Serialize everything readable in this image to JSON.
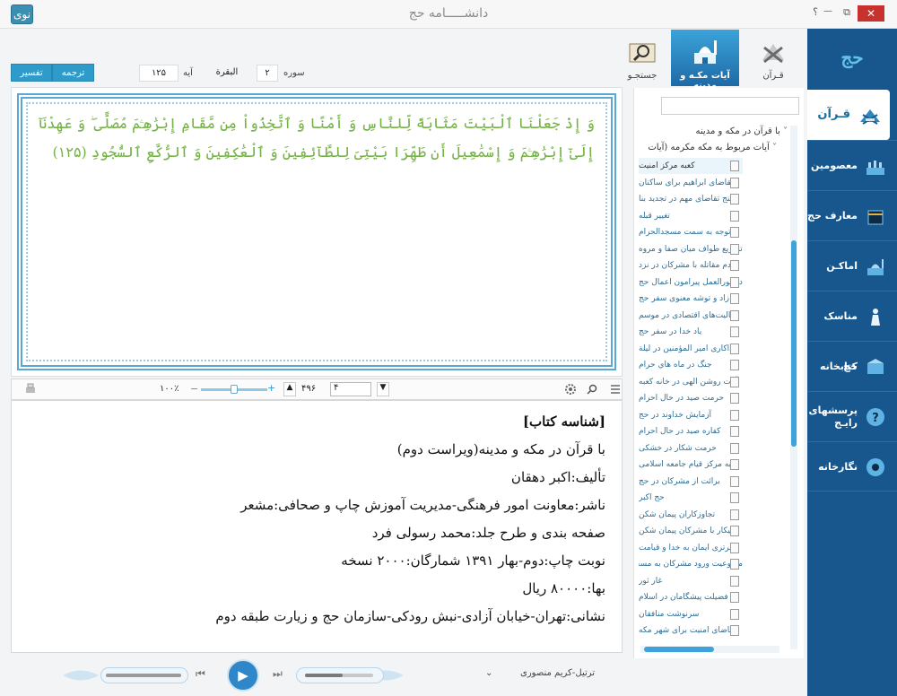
{
  "window": {
    "title": "دانشـــــامه حج",
    "app_icon_text": "نوی",
    "help": "؟",
    "restore": "⧉",
    "minimize": "—",
    "close": "✕"
  },
  "logo": "حج دانشنامه",
  "sidebar": {
    "items": [
      {
        "label": "قـرآن",
        "icon": "quran-icon",
        "active": true
      },
      {
        "label": "معصومین",
        "icon": "ruins-icon"
      },
      {
        "label": "معارف حج",
        "icon": "kaaba-icon"
      },
      {
        "label": "اماکـن",
        "icon": "mosque-icon"
      },
      {
        "label": "مناسک حج",
        "icon": "pilgrim-icon"
      },
      {
        "label": "کتابخانه",
        "icon": "library-icon"
      },
      {
        "label": "پرسشهای رایـج",
        "icon": "faq-icon"
      },
      {
        "label": "نگارخانه",
        "icon": "gallery-icon"
      }
    ]
  },
  "tabs": [
    {
      "label": "قـرآن",
      "icon": "quran-stand-icon"
    },
    {
      "label": "آیات مکـه و مدینه",
      "icon": "mosque-tab-icon",
      "active": true
    },
    {
      "label": "جستجـو",
      "icon": "book-search-icon"
    }
  ],
  "verse_nav": {
    "surah_label": "سوره",
    "surah_number": "۲",
    "surah_name": "البقرة",
    "ayah_label": "آیه",
    "ayah_number": "۱۲۵",
    "translation_button": "ترجمه",
    "tafsir_button": "تفسیر"
  },
  "verse": {
    "text": "وَ إِذْ جَعَلْنَا ٱلْبَيْتَ مَثَابَةً لِّلنَّاسِ وَ أَمْنًا وَ ٱتَّخِذُواْ مِن مَّقَامِ إِبْرَٰهِـۧمَ مُصَلًّى ۖ وَ عَهِدْنَآ إِلَىٰٓ إِبْرَٰهِـۧمَ وَ إِسْمَٰعِيلَ أَن طَهِّرَا بَيْتِىَ لِلطَّآئِفِينَ وَ ٱلْعَٰكِفِينَ وَ ٱلرُّكَّعِ ٱلسُّجُودِ",
    "number": "(۱۲۵)"
  },
  "doc_toolbar": {
    "zoom": "۱۰۰٪",
    "page_current": "۴",
    "page_total": "۴۹۶",
    "zoom_level": 0.5
  },
  "doc": {
    "heading": "[شناسه کتاب]",
    "lines": [
      "با قرآن در مکه و مدینه(ویراست دوم)",
      "تألیف:اکبر دهقان",
      "ناشر:معاونت امور فرهنگی-مدیریت آموزش چاپ و صحافی:مشعر",
      "صفحه بندی و طرح جلد:محمد رسولی فرد",
      "نوبت چاپ:دوم-بهار ۱۳۹۱ شمارگان:۲۰۰۰ نسخه",
      "بها:۸۰۰۰۰ ریال",
      "نشانی:تهران-خیابان آزادی-نبش رودکی-سازمان حج و زیارت طبقه دوم"
    ]
  },
  "tree": {
    "root": "با قرآن در مکه و مدینه",
    "group": "آیات مربوط به مکه مکرمه (آیات",
    "items": [
      "کعبه مرکز امنیت",
      "تقاضای ابراهیم برای ساکنان",
      "پنج تقاضای مهم در تجدید بنا",
      "تغییر قبله",
      "توجه به سمت مسجدالحرام",
      "تشریع طواف میان صفا و مروه",
      "عدم مقاتله با مشرکان در نزد",
      "دستورالعمل پیرامون اعمال حج",
      "زاد و توشه معنوی سفر حج",
      "فعالیت‌های اقتصادی در موسم",
      "یاد خدا در سفر حج",
      "فداکاری امیر المؤمنین در لیلة",
      "جنگ در ماه هاي حرام",
      "آیات روشن الهی در خانه کعبه",
      "حرمت صید در حال احرام",
      "آزمایش خداوند در حج",
      "کفاره صید در حال احرام",
      "حرمت شکار در خشکی",
      "کعبه مرکز قیام جامعه اسلامی",
      "برائت از مشرکان در حج",
      "حج اکبر",
      "تجاوزکاران پیمان شکن",
      "پیکار با مشرکان پیمان شکن",
      "برتری ایمان به خدا و قیامت",
      "ممنوعیت ورود مشرکان به مسجد",
      "غار ثور",
      "فضیلت پیشگامان در اسلام",
      "سرنوشت منافقان",
      "تقاضای امنیت برای شهر مکه"
    ]
  },
  "player": {
    "reciter": "ترتیل-کریم منصوری",
    "progress": 0.0,
    "volume": 0.55
  }
}
